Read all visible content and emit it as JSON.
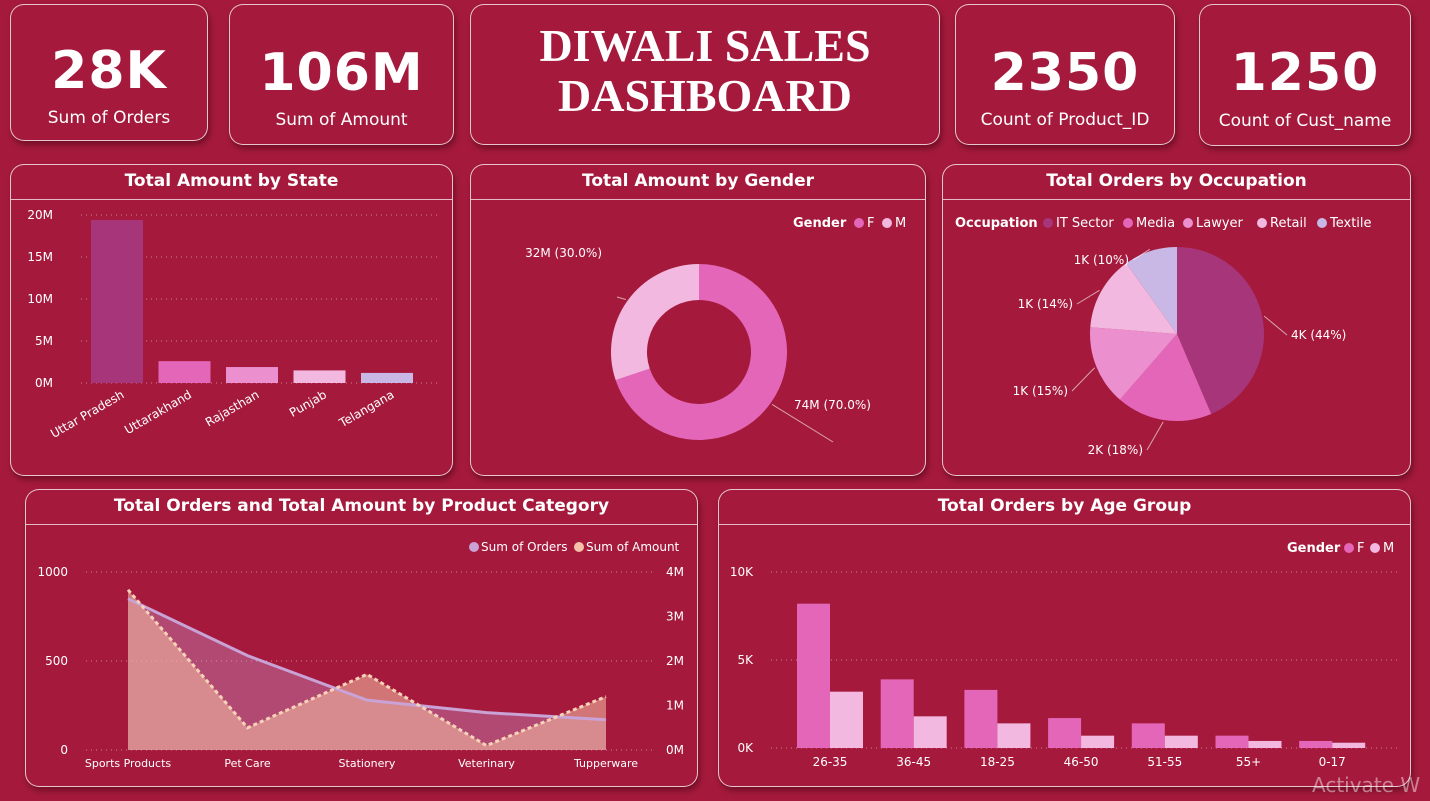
{
  "kpis": {
    "orders": {
      "value": "28K",
      "label": "Sum of Orders"
    },
    "amount": {
      "value": "106M",
      "label": "Sum of Amount"
    },
    "products": {
      "value": "2350",
      "label": "Count of Product_ID"
    },
    "customers": {
      "value": "1250",
      "label": "Count of Cust_name"
    }
  },
  "header": {
    "title_line1": "DIWALI SALES",
    "title_line2": "DASHBOARD"
  },
  "watermark": "Activate W",
  "colors": {
    "background": "#a51a3c",
    "female": "#e466b9",
    "male": "#f2b8df",
    "it_sector": "#a6357a",
    "media": "#e466b9",
    "lawyer": "#eb8fcf",
    "retail": "#f2b8df",
    "textile": "#c9b8e6"
  },
  "chart_data": [
    {
      "type": "bar",
      "title": "Total Amount by State",
      "categories": [
        "Uttar Pradesh",
        "Uttarakhand",
        "Rajasthan",
        "Punjab",
        "Telangana"
      ],
      "values": [
        19.4,
        2.6,
        1.9,
        1.5,
        1.2
      ],
      "value_unit": "M",
      "ylim": [
        0,
        20
      ],
      "y_ticks": [
        "0M",
        "5M",
        "10M",
        "15M",
        "20M"
      ],
      "bar_colors": [
        "#a6357a",
        "#e466b9",
        "#eb8fcf",
        "#f2b8df",
        "#c9b8e6"
      ],
      "grid": true
    },
    {
      "type": "pie",
      "variant": "donut",
      "title": "Total Amount by Gender",
      "legend_title": "Gender",
      "legend_position": "top-right",
      "slices": [
        {
          "name": "F",
          "value": 74,
          "label": "74M (70.0%)"
        },
        {
          "name": "M",
          "value": 32,
          "label": "32M (30.0%)"
        }
      ]
    },
    {
      "type": "pie",
      "title": "Total Orders by Occupation",
      "legend_title": "Occupation",
      "legend_position": "top",
      "slices": [
        {
          "name": "IT Sector",
          "value": 44,
          "label": "4K (44%)"
        },
        {
          "name": "Media",
          "value": 18,
          "label": "2K (18%)"
        },
        {
          "name": "Lawyer",
          "value": 15,
          "label": "1K (15%)"
        },
        {
          "name": "Retail",
          "value": 14,
          "label": "1K (14%)"
        },
        {
          "name": "Textile",
          "value": 10,
          "label": "1K (10%)"
        }
      ]
    },
    {
      "type": "area",
      "title": "Total Orders and Total Amount by Product Category",
      "categories": [
        "Sports Products",
        "Pet Care",
        "Stationery",
        "Veterinary",
        "Tupperware"
      ],
      "series": [
        {
          "name": "Sum of Orders",
          "axis": "left",
          "values": [
            850,
            530,
            280,
            210,
            170
          ]
        },
        {
          "name": "Sum of Amount",
          "axis": "right",
          "values": [
            3.6,
            0.5,
            1.7,
            0.1,
            1.2
          ]
        }
      ],
      "y_left": {
        "ylim": [
          0,
          1000
        ],
        "ticks": [
          "0",
          "500",
          "1000"
        ]
      },
      "y_right": {
        "ylim": [
          0,
          4
        ],
        "unit": "M",
        "ticks": [
          "0M",
          "1M",
          "2M",
          "3M",
          "4M"
        ]
      },
      "legend_position": "top-right",
      "grid": true
    },
    {
      "type": "bar",
      "title": "Total Orders by Age Group",
      "categories": [
        "26-35",
        "36-45",
        "18-25",
        "46-50",
        "51-55",
        "55+",
        "0-17"
      ],
      "legend_title": "Gender",
      "legend_position": "top-right",
      "series": [
        {
          "name": "F",
          "values": [
            8.2,
            3.9,
            3.3,
            1.7,
            1.4,
            0.7,
            0.4
          ]
        },
        {
          "name": "M",
          "values": [
            3.2,
            1.8,
            1.4,
            0.7,
            0.7,
            0.4,
            0.3
          ]
        }
      ],
      "value_unit": "K",
      "ylim": [
        0,
        10
      ],
      "y_ticks": [
        "0K",
        "5K",
        "10K"
      ],
      "grid": true
    }
  ]
}
